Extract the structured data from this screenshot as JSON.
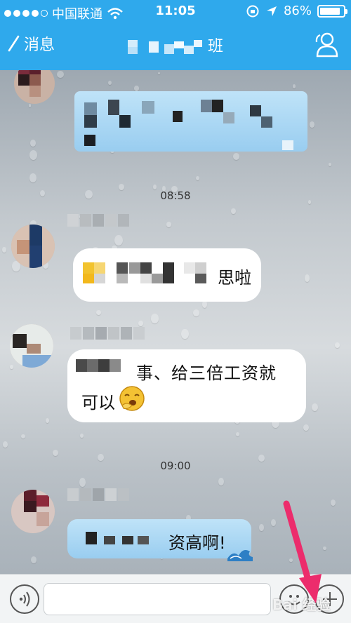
{
  "status_bar": {
    "carrier": "中国联通",
    "time": "11:05",
    "battery": "86%",
    "battery_level": 0.86
  },
  "nav": {
    "back_label": "消息",
    "title": "班"
  },
  "messages": [
    {
      "kind": "timestamp",
      "text": "08:58"
    },
    {
      "kind": "text",
      "visible_text": "思啦"
    },
    {
      "kind": "text",
      "visible_text_line1": "事、给三倍工资就",
      "visible_text_line2": "可以"
    },
    {
      "kind": "timestamp",
      "text": "09:00"
    },
    {
      "kind": "text",
      "visible_text": "资高啊!"
    }
  ],
  "input": {
    "placeholder": ""
  },
  "watermark": "Bai 经验",
  "colors": {
    "nav_bg": "#2fa9ec",
    "bubble_blue": "#a9d6f3",
    "annotation_arrow": "#ec2c6c"
  }
}
